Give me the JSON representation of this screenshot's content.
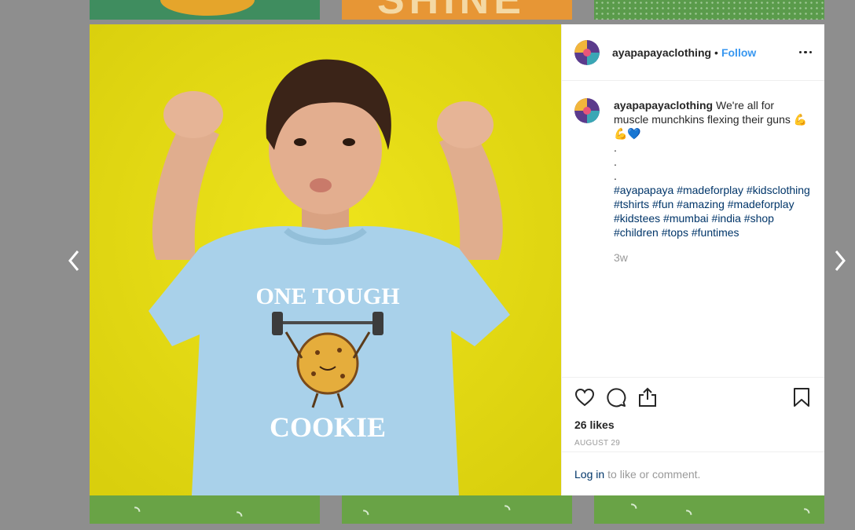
{
  "post": {
    "username": "ayapapayaclothing",
    "separator": "•",
    "follow_label": "Follow",
    "caption": "We're all for muscle munchkins flexing their guns 💪💪💙",
    "caption_dots": [
      ".",
      ".",
      "."
    ],
    "hashtags": [
      "#ayapapaya",
      "#madeforplay",
      "#kidsclothing",
      "#tshirts",
      "#fun",
      "#amazing",
      "#madeforplay",
      "#kidstees",
      "#mumbai",
      "#india",
      "#shop",
      "#children",
      "#tops",
      "#funtimes"
    ],
    "time_ago": "3w",
    "likes": "26 likes",
    "date": "AUGUST 29",
    "login_link": "Log in",
    "login_suffix": "to like or comment.",
    "shirt_text_top": "ONE TOUGH",
    "shirt_text_bottom": "COOKIE"
  },
  "background_tiles": {
    "top_middle_word": "SHINE"
  },
  "icons": {
    "like": "heart-icon",
    "comment": "comment-icon",
    "share": "share-icon",
    "save": "bookmark-icon",
    "more": "more-options-icon",
    "prev": "chevron-left-icon",
    "next": "chevron-right-icon"
  },
  "colors": {
    "follow_blue": "#3897f0",
    "hashtag_blue": "#003569",
    "photo_background": "#e6db12",
    "overlay_gray": "#8e8e8e"
  }
}
